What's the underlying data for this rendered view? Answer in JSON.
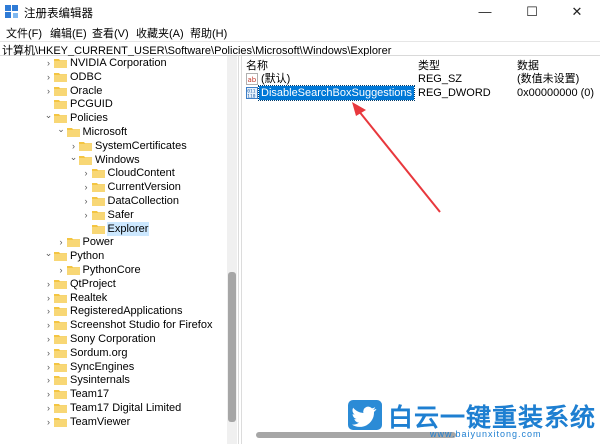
{
  "window": {
    "title": "注册表编辑器",
    "min_glyph": "—",
    "max_glyph": "☐",
    "close_glyph": "✕"
  },
  "menu": [
    "文件(F)",
    "编辑(E)",
    "查看(V)",
    "收藏夹(A)",
    "帮助(H)"
  ],
  "address": "计算机\\HKEY_CURRENT_USER\\Software\\Policies\\Microsoft\\Windows\\Explorer",
  "tree": [
    {
      "label": "NVIDIA Corporation",
      "expander": "right",
      "depth": 0
    },
    {
      "label": "ODBC",
      "expander": "right",
      "depth": 0
    },
    {
      "label": "Oracle",
      "expander": "right",
      "depth": 0
    },
    {
      "label": "PCGUID",
      "expander": "none",
      "depth": 0
    },
    {
      "label": "Policies",
      "expander": "down",
      "depth": 0
    },
    {
      "label": "Microsoft",
      "expander": "down",
      "depth": 1
    },
    {
      "label": "SystemCertificates",
      "expander": "right",
      "depth": 2
    },
    {
      "label": "Windows",
      "expander": "down",
      "depth": 2
    },
    {
      "label": "CloudContent",
      "expander": "right",
      "depth": 3
    },
    {
      "label": "CurrentVersion",
      "expander": "right",
      "depth": 3
    },
    {
      "label": "DataCollection",
      "expander": "right",
      "depth": 3
    },
    {
      "label": "Safer",
      "expander": "right",
      "depth": 3
    },
    {
      "label": "Explorer",
      "expander": "none",
      "depth": 3,
      "selected": true
    },
    {
      "label": "Power",
      "expander": "right",
      "depth": 1
    },
    {
      "label": "Python",
      "expander": "down",
      "depth": 0
    },
    {
      "label": "PythonCore",
      "expander": "right",
      "depth": 1
    },
    {
      "label": "QtProject",
      "expander": "right",
      "depth": 0
    },
    {
      "label": "Realtek",
      "expander": "right",
      "depth": 0
    },
    {
      "label": "RegisteredApplications",
      "expander": "right",
      "depth": 0
    },
    {
      "label": "Screenshot Studio for Firefox",
      "expander": "right",
      "depth": 0
    },
    {
      "label": "Sony Corporation",
      "expander": "right",
      "depth": 0
    },
    {
      "label": "Sordum.org",
      "expander": "right",
      "depth": 0
    },
    {
      "label": "SyncEngines",
      "expander": "right",
      "depth": 0
    },
    {
      "label": "Sysinternals",
      "expander": "right",
      "depth": 0
    },
    {
      "label": "Team17",
      "expander": "right",
      "depth": 0
    },
    {
      "label": "Team17 Digital Limited",
      "expander": "right",
      "depth": 0
    },
    {
      "label": "TeamViewer",
      "expander": "right",
      "depth": 0
    }
  ],
  "columns": {
    "name": "名称",
    "type": "类型",
    "data": "数据"
  },
  "values": [
    {
      "name": "(默认)",
      "type": "REG_SZ",
      "data": "(数值未设置)",
      "icon": "string-value-icon"
    },
    {
      "name": "DisableSearchBoxSuggestions",
      "type": "REG_DWORD",
      "data": "0x00000000 (0)",
      "icon": "binary-value-icon",
      "selected": true
    }
  ],
  "watermark": {
    "title": "白云一键重装系统",
    "url": "www.baiyunxitong.com"
  },
  "colors": {
    "selection": "#0078d7",
    "tree_selection": "#cce8ff",
    "folder": "#f4c542",
    "arrow": "#e8383d",
    "watermark": "#1e7fd1"
  }
}
